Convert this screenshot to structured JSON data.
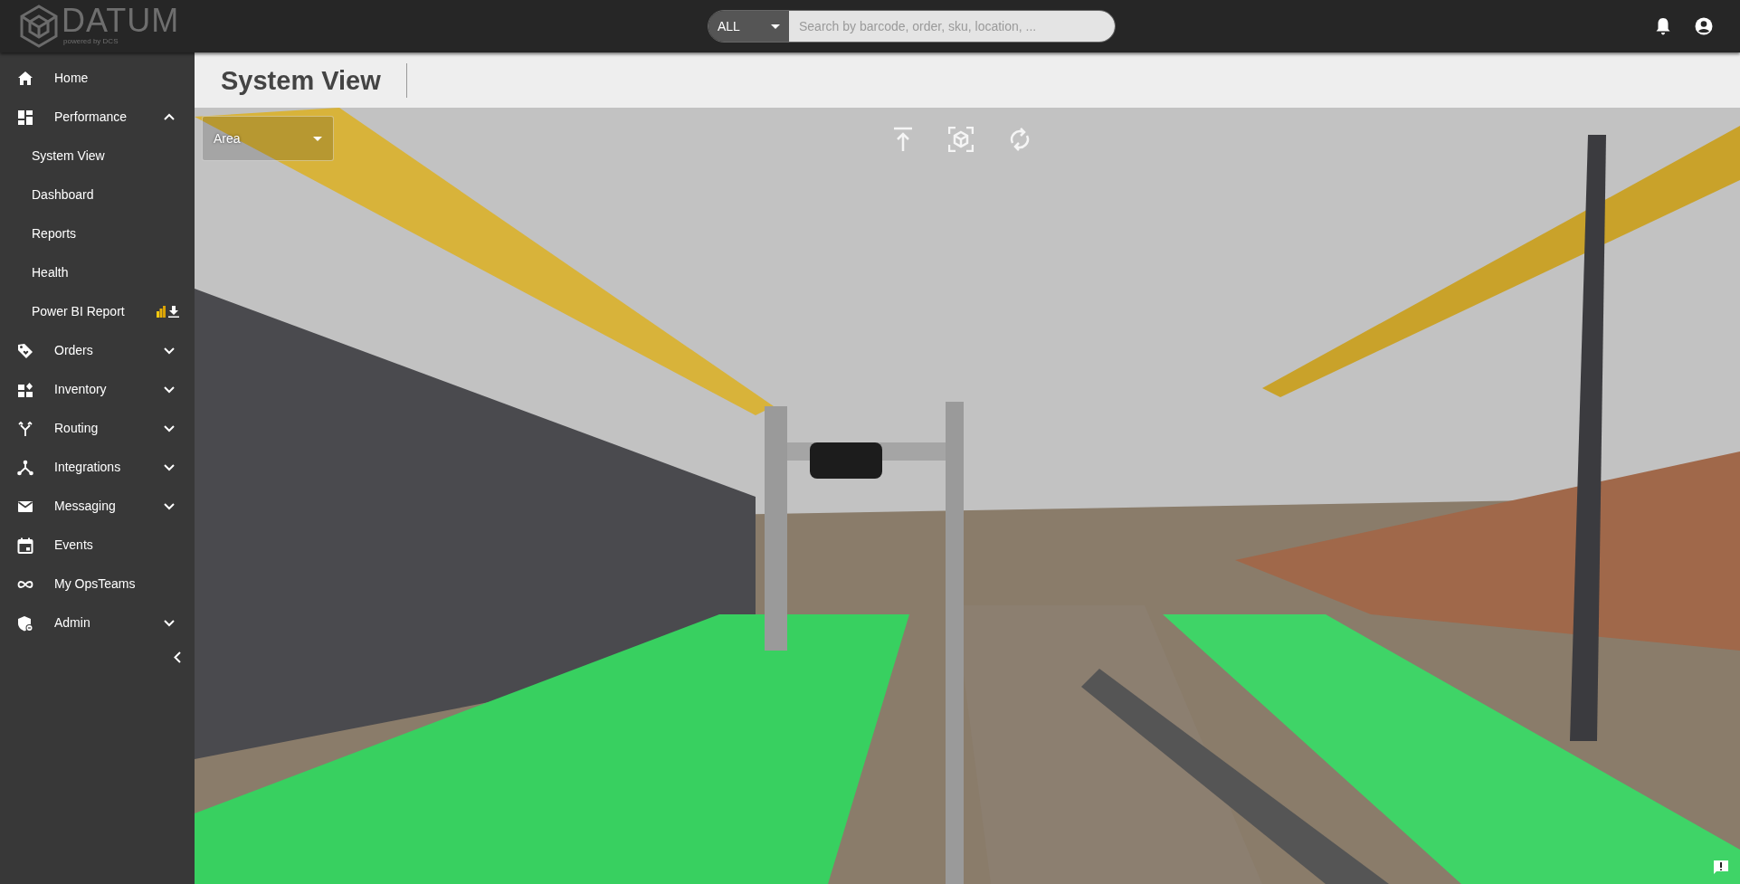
{
  "header": {
    "logo": {
      "name": "DATUM",
      "tagline": "powered by DCS"
    },
    "search": {
      "scope": "ALL",
      "placeholder": "Search by barcode, order, sku, location, ..."
    }
  },
  "sidebar": {
    "items": [
      {
        "kind": "link",
        "label": "Home"
      },
      {
        "kind": "group",
        "label": "Performance",
        "expanded": true,
        "children": [
          {
            "label": "System View"
          },
          {
            "label": "Dashboard"
          },
          {
            "label": "Reports"
          },
          {
            "label": "Health"
          },
          {
            "label": "Power BI Report",
            "download": true
          }
        ]
      },
      {
        "kind": "group",
        "label": "Orders",
        "expanded": false
      },
      {
        "kind": "group",
        "label": "Inventory",
        "expanded": false
      },
      {
        "kind": "group",
        "label": "Routing",
        "expanded": false
      },
      {
        "kind": "group",
        "label": "Integrations",
        "expanded": false
      },
      {
        "kind": "group",
        "label": "Messaging",
        "expanded": false
      },
      {
        "kind": "link",
        "label": "Events"
      },
      {
        "kind": "link",
        "label": "My OpsTeams"
      },
      {
        "kind": "group",
        "label": "Admin",
        "expanded": false
      }
    ]
  },
  "page": {
    "title": "System View",
    "area_select": {
      "placeholder": "Area"
    }
  }
}
